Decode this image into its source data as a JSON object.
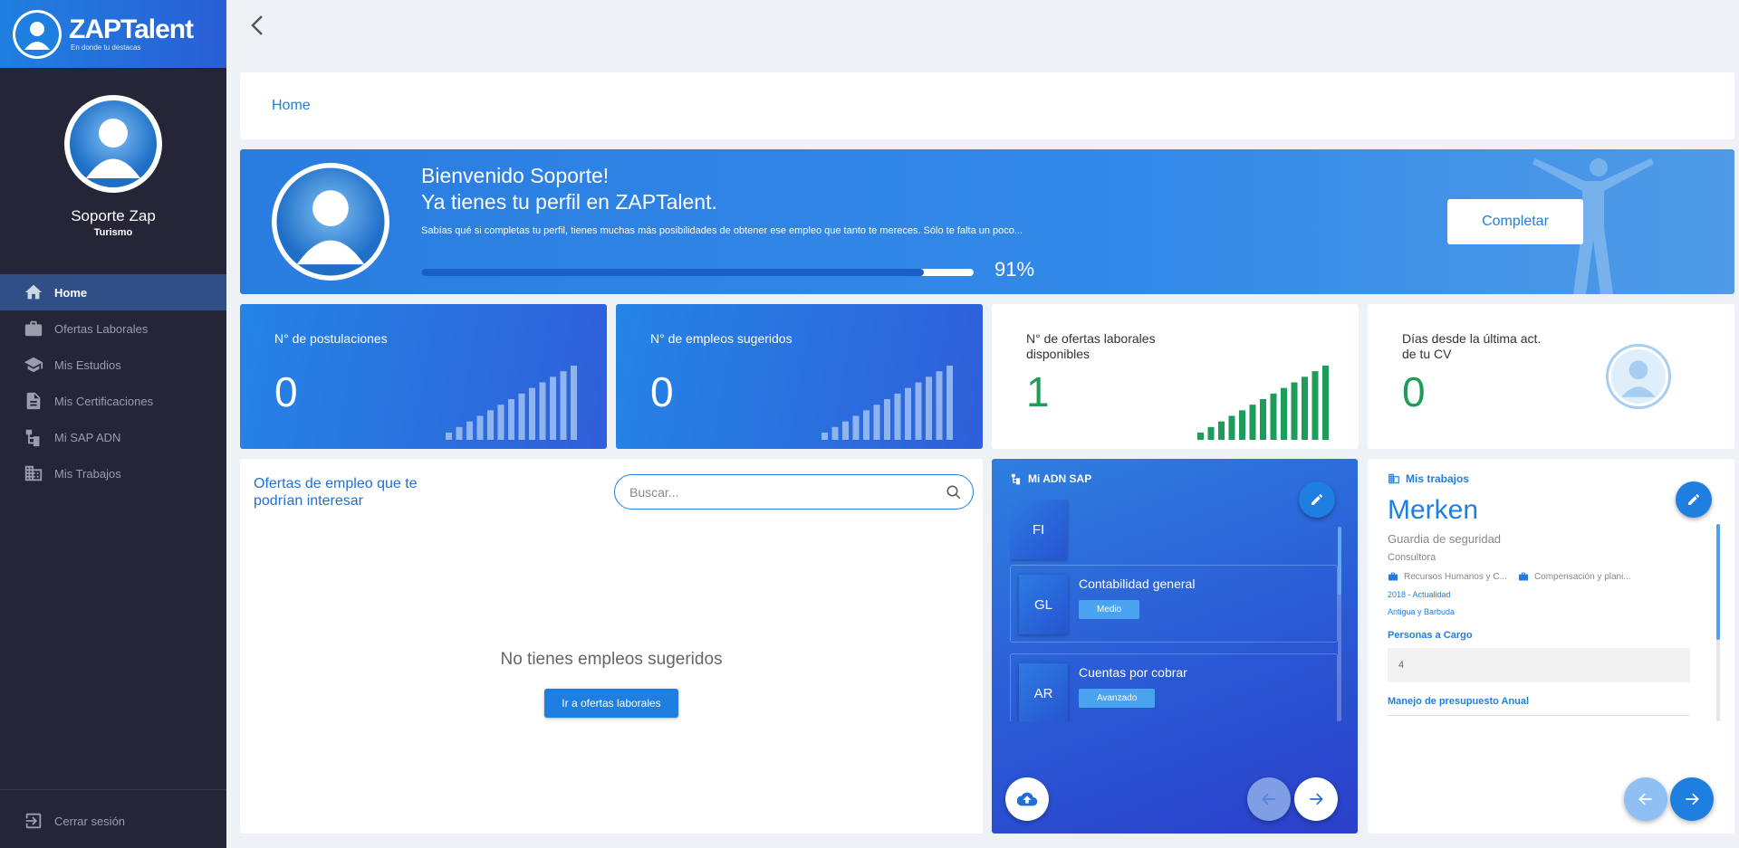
{
  "brand": {
    "name": "ZAPTalent",
    "tagline": "En donde tu destacas"
  },
  "profile": {
    "name": "Soporte Zap",
    "sector": "Turismo"
  },
  "sidebar": {
    "items": [
      {
        "label": "Home",
        "icon": "home-icon",
        "active": true
      },
      {
        "label": "Ofertas Laborales",
        "icon": "briefcase-icon"
      },
      {
        "label": "Mis Estudios",
        "icon": "graduation-cap-icon"
      },
      {
        "label": "Mis Certificaciones",
        "icon": "document-icon"
      },
      {
        "label": "Mi SAP ADN",
        "icon": "hierarchy-icon"
      },
      {
        "label": "Mis Trabajos",
        "icon": "building-icon"
      }
    ],
    "logout": "Cerrar sesión"
  },
  "breadcrumb": {
    "current": "Home"
  },
  "welcome": {
    "line1": "Bienvenido Soporte!",
    "line2": "Ya tienes tu perfil en ZAPTalent.",
    "line3": "Sabías qué si completas tu perfil, tienes muchas más posibilidades de obtener ese empleo que tanto te mereces. Sólo te falta un poco...",
    "progress_percent": 91,
    "progress_label": "91%",
    "button_label": "Completar"
  },
  "stats": [
    {
      "label": "N° de postulaciones",
      "value": "0"
    },
    {
      "label": "N° de empleos sugeridos",
      "value": "0"
    },
    {
      "label": "N° de ofertas laborales disponibles",
      "value": "1"
    },
    {
      "label": "Días desde la última act. de tu CV",
      "value": "0"
    }
  ],
  "offers": {
    "title": "Ofertas de empleo que te podrían interesar",
    "search_placeholder": "Buscar...",
    "empty_message": "No tienes empleos sugeridos",
    "button_label": "Ir a ofertas laborales"
  },
  "adn": {
    "title": "Mi ADN SAP",
    "module": "FI",
    "items": [
      {
        "code": "GL",
        "name": "Contabilidad general",
        "level": "Medio"
      },
      {
        "code": "AR",
        "name": "Cuentas por cobrar",
        "level": "Avanzado"
      }
    ]
  },
  "jobs": {
    "title": "Mis trabajos",
    "company": "Merken",
    "role": "Guardia de seguridad",
    "type": "Consultora",
    "tags": [
      "Recursos Humanos y C...",
      "Compensación y plani..."
    ],
    "period": "2018 - Actualidad",
    "country": "Antigua y Barbuda",
    "section1_label": "Personas a Cargo",
    "section1_value": "4",
    "section2_label": "Manejo de presupuesto Anual"
  },
  "colors": {
    "primary": "#1f7fe0",
    "sidebar": "#242637",
    "success": "#1e9c5a"
  }
}
